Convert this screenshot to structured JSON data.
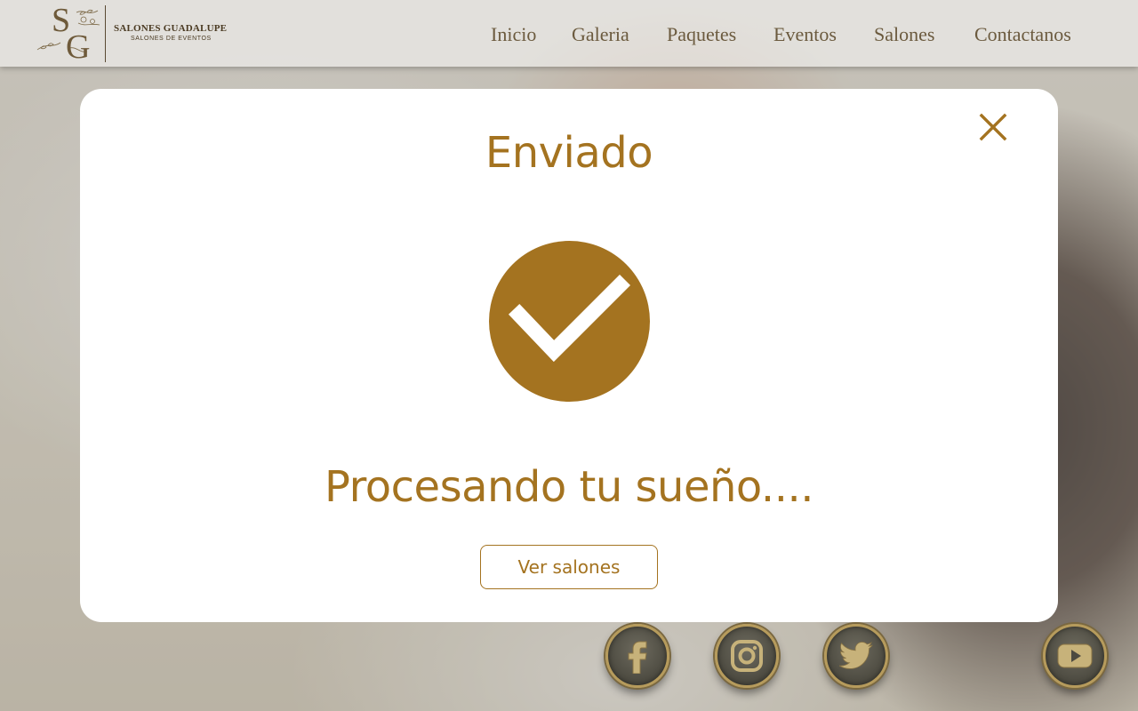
{
  "brand": {
    "monogram_s": "S",
    "monogram_g": "G",
    "name": "SALONES GUADALUPE",
    "tagline": "SALONES DE EVENTOS"
  },
  "nav": {
    "items": [
      {
        "label": "Inicio"
      },
      {
        "label": "Galeria"
      },
      {
        "label": "Paquetes"
      },
      {
        "label": "Eventos"
      },
      {
        "label": "Salones"
      },
      {
        "label": "Contactanos"
      }
    ]
  },
  "modal": {
    "title": "Enviado",
    "message": "Procesando tu sueño....",
    "button_label": "Ver salones",
    "close_icon": "close-icon",
    "status_icon": "check-circle-icon"
  },
  "social": {
    "items": [
      {
        "icon": "facebook-icon"
      },
      {
        "icon": "instagram-icon"
      },
      {
        "icon": "twitter-icon"
      },
      {
        "icon": "youtube-icon"
      }
    ]
  },
  "colors": {
    "accent": "#a47320",
    "nav_text": "#6b5a3e",
    "modal_bg": "#ffffff",
    "social_ring": "#b69b5c"
  }
}
